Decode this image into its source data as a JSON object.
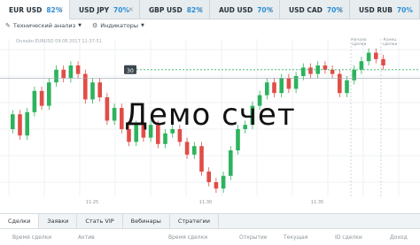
{
  "tabs": [
    {
      "symbol": "EUR USD",
      "percent": "82%"
    },
    {
      "symbol": "USD JPY",
      "percent": "70%"
    },
    {
      "symbol": "GBP USD",
      "percent": "82%"
    },
    {
      "symbol": "AUD USD",
      "percent": "70%"
    },
    {
      "symbol": "USD CAD",
      "percent": "70%"
    },
    {
      "symbol": "USD RUB",
      "percent": "70%"
    }
  ],
  "toolbar": {
    "analysis": "Технический анализ",
    "indicators": "Индикаторы"
  },
  "chart": {
    "hint": "Онлайн EURUSD 09.08.2017 11:37:51",
    "price_badge": "30",
    "time_labels": [
      "11:25",
      "11:30",
      "11:35"
    ],
    "end_label_line1": "Начало",
    "end_label_line2": "сделки",
    "close_label_line1": "Конец",
    "close_label_line2": "сделки",
    "candles": [
      {
        "o": 30,
        "c": 37
      },
      {
        "o": 37,
        "c": 27
      },
      {
        "o": 27,
        "c": 38
      },
      {
        "o": 38,
        "c": 48
      },
      {
        "o": 48,
        "c": 41
      },
      {
        "o": 41,
        "c": 52
      },
      {
        "o": 52,
        "c": 58
      },
      {
        "o": 58,
        "c": 54
      },
      {
        "o": 54,
        "c": 60
      },
      {
        "o": 60,
        "c": 56
      },
      {
        "o": 56,
        "c": 44
      },
      {
        "o": 44,
        "c": 52
      },
      {
        "o": 52,
        "c": 45
      },
      {
        "o": 45,
        "c": 34
      },
      {
        "o": 34,
        "c": 40
      },
      {
        "o": 40,
        "c": 30
      },
      {
        "o": 30,
        "c": 24
      },
      {
        "o": 24,
        "c": 32
      },
      {
        "o": 32,
        "c": 26
      },
      {
        "o": 26,
        "c": 32
      },
      {
        "o": 32,
        "c": 23
      },
      {
        "o": 23,
        "c": 28
      },
      {
        "o": 28,
        "c": 30
      },
      {
        "o": 30,
        "c": 24
      },
      {
        "o": 24,
        "c": 18
      },
      {
        "o": 18,
        "c": 22
      },
      {
        "o": 22,
        "c": 10
      },
      {
        "o": 10,
        "c": 5
      },
      {
        "o": 5,
        "c": 2
      },
      {
        "o": 2,
        "c": 8
      },
      {
        "o": 8,
        "c": 20
      },
      {
        "o": 20,
        "c": 30
      },
      {
        "o": 30,
        "c": 32
      },
      {
        "o": 32,
        "c": 41
      },
      {
        "o": 41,
        "c": 46
      },
      {
        "o": 46,
        "c": 52
      },
      {
        "o": 52,
        "c": 47
      },
      {
        "o": 47,
        "c": 54
      },
      {
        "o": 54,
        "c": 49
      },
      {
        "o": 49,
        "c": 55
      },
      {
        "o": 55,
        "c": 59
      },
      {
        "o": 59,
        "c": 56
      },
      {
        "o": 56,
        "c": 60
      },
      {
        "o": 60,
        "c": 58
      },
      {
        "o": 58,
        "c": 56
      },
      {
        "o": 56,
        "c": 47
      },
      {
        "o": 47,
        "c": 53
      },
      {
        "o": 53,
        "c": 58
      },
      {
        "o": 58,
        "c": 62
      },
      {
        "o": 62,
        "c": 66
      },
      {
        "o": 66,
        "c": 63
      },
      {
        "o": 63,
        "c": 60
      }
    ]
  },
  "watermark": "Демо счет",
  "bottom_tabs": [
    "Сделки",
    "Заявки",
    "Стать VIP",
    "Вебинары",
    "Стратегии"
  ],
  "columns": [
    "Время сделки",
    "Актив",
    "Время сделки",
    "Открытие",
    "Текущая",
    "ID сделки",
    "Доход"
  ],
  "colors": {
    "up": "#2db35d",
    "down": "#e14d47",
    "accent": "#2d8fd5",
    "level": "#2db35d"
  }
}
